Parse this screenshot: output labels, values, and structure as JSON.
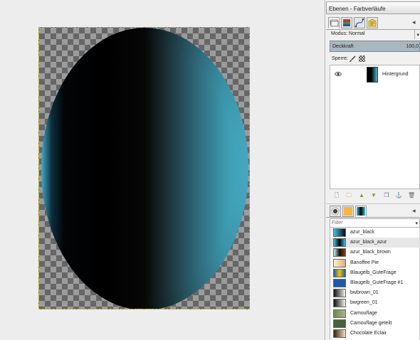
{
  "panel": {
    "title": "Ebenen - Farbverläufe"
  },
  "layers": {
    "mode_label": "Modus:",
    "mode_value": "Normal",
    "opacity_label": "Deckkraft",
    "opacity_value": "100,0",
    "lock_label": "Sperre:",
    "layer_name": "Hintergrund"
  },
  "gradients": {
    "filter_placeholder": "Filter",
    "items": [
      {
        "name": "azur_black",
        "colors": [
          "#3cc3e8",
          "#0a0a0a"
        ]
      },
      {
        "name": "azur_black_azur",
        "colors": [
          "#3cc3e8",
          "#000000",
          "#3cc3e8"
        ]
      },
      {
        "name": "azur_black_brown",
        "colors": [
          "#c7eef8",
          "#101010",
          "#8a3a14"
        ]
      },
      {
        "name": "Banoffee Pie",
        "colors": [
          "#fff1cf",
          "#d9b07c"
        ]
      },
      {
        "name": "Blaugelb_GuteFrage",
        "colors": [
          "#1f5aa5",
          "#f2c200",
          "#1f5aa5"
        ]
      },
      {
        "name": "Blaugelb_GuteFrage #1",
        "colors": [
          "#1f5aa5",
          "#1f5aa5"
        ]
      },
      {
        "name": "bwbrown_01",
        "colors": [
          "#111111",
          "#f4f0e8"
        ]
      },
      {
        "name": "bwgreen_01",
        "colors": [
          "#111111",
          "#eef4ea"
        ]
      },
      {
        "name": "Camouflage",
        "colors": [
          "#6d8a55",
          "#a8b38a"
        ]
      },
      {
        "name": "Camouflage geteilt",
        "colors": [
          "#49613b",
          "#49613b"
        ]
      },
      {
        "name": "Chocolate Eclair",
        "colors": [
          "#3b2010",
          "#f1dcc0"
        ]
      }
    ]
  }
}
